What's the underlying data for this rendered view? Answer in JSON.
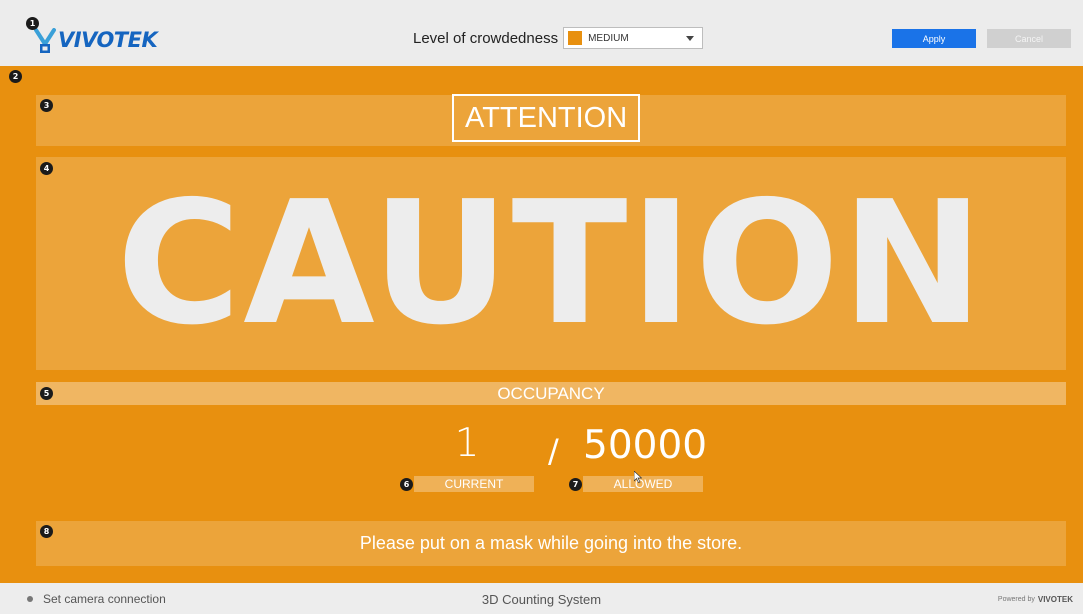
{
  "header": {
    "logo_text": "VIVOTEK",
    "crowd_label": "Level of crowdedness",
    "crowd_selected": "MEDIUM",
    "crowd_color": "#e8900f",
    "apply_label": "Apply",
    "cancel_label": "Cancel"
  },
  "markers": [
    "1",
    "2",
    "3",
    "4",
    "5",
    "6",
    "7",
    "8"
  ],
  "sign": {
    "attention": "ATTENTION",
    "caution": "CAUTION",
    "occupancy_label": "OCCUPANCY",
    "current": "1",
    "separator": "/",
    "allowed": "50000",
    "current_label": "CURRENT",
    "allowed_label": "ALLOWED",
    "message": "Please put on a mask while going into the store.",
    "background_color": "#e8900f"
  },
  "footer": {
    "status": "Set camera connection",
    "system_name": "3D Counting System",
    "powered_by": "Powered by",
    "powered_logo": "VIVOTEK"
  },
  "icons": [
    "vivotek-logo-icon",
    "chevron-down-icon",
    "status-dot-icon",
    "mouse-cursor-icon"
  ]
}
